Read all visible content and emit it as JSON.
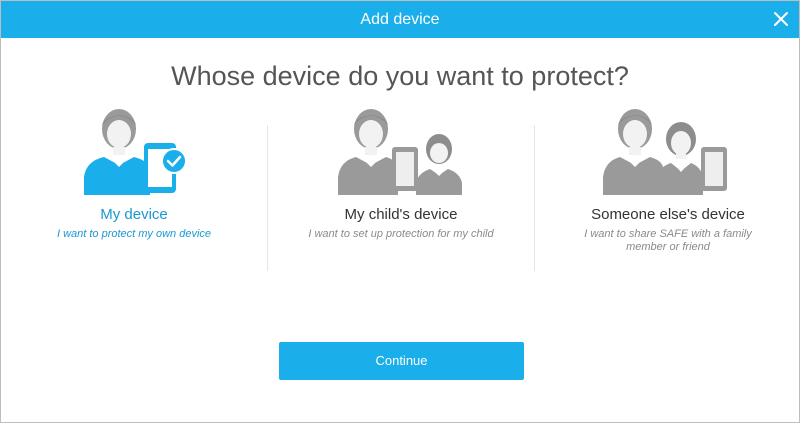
{
  "window": {
    "title": "Add device",
    "close_icon": "close-icon"
  },
  "heading": "Whose device do you want to protect?",
  "options": [
    {
      "title": "My device",
      "description": "I want to protect my own device",
      "icon": "person-with-tablet-check-icon",
      "selected": true
    },
    {
      "title": "My child's device",
      "description": "I want to set up protection for my child",
      "icon": "parent-tablet-child-icon",
      "selected": false
    },
    {
      "title": "Someone else's device",
      "description": "I want to share SAFE with a family member or friend",
      "icon": "two-people-tablet-icon",
      "selected": false
    }
  ],
  "continue_label": "Continue",
  "colors": {
    "accent": "#1aaeea",
    "selected_text": "#1a98d0",
    "icon_gray": "#9a9a9a",
    "heading": "#555555"
  }
}
